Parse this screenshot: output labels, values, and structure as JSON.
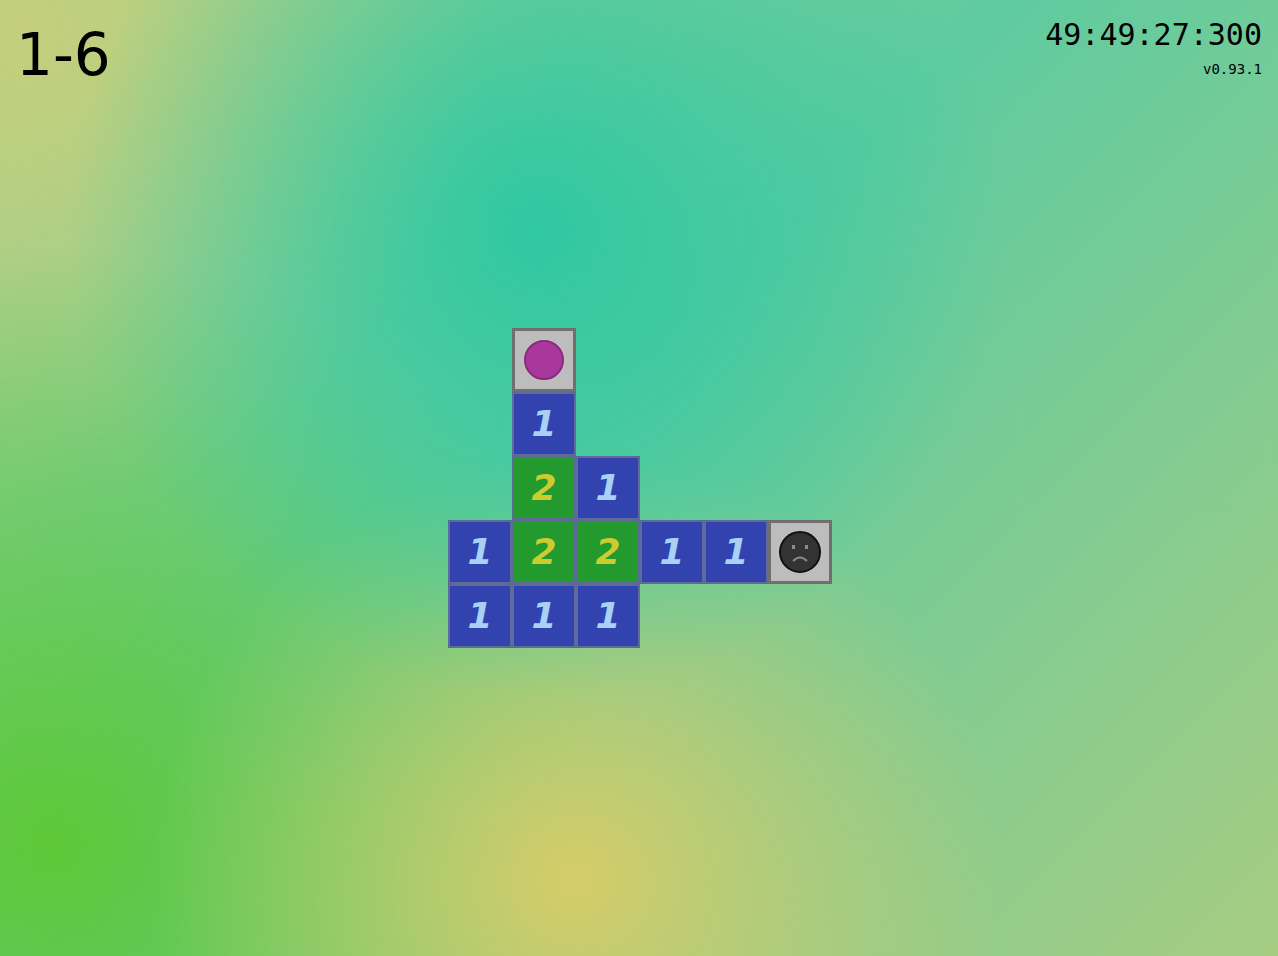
{
  "level": "1-6",
  "timer": "49:49:27:300",
  "version": "v0.93.1",
  "board": {
    "rows": [
      [
        {
          "kind": "empty"
        },
        {
          "kind": "dot"
        },
        {
          "kind": "empty"
        },
        {
          "kind": "empty"
        },
        {
          "kind": "empty"
        },
        {
          "kind": "empty"
        }
      ],
      [
        {
          "kind": "empty"
        },
        {
          "kind": "blue",
          "text": "1",
          "color": "#3243b0"
        },
        {
          "kind": "empty"
        },
        {
          "kind": "empty"
        },
        {
          "kind": "empty"
        },
        {
          "kind": "empty"
        }
      ],
      [
        {
          "kind": "empty"
        },
        {
          "kind": "green",
          "text": "2",
          "color": "#229a2e"
        },
        {
          "kind": "blue",
          "text": "1",
          "color": "#3243b0"
        },
        {
          "kind": "empty"
        },
        {
          "kind": "empty"
        },
        {
          "kind": "empty"
        }
      ],
      [
        {
          "kind": "blue",
          "text": "1",
          "color": "#3243b0"
        },
        {
          "kind": "green",
          "text": "2",
          "color": "#229a2e"
        },
        {
          "kind": "green",
          "text": "2",
          "color": "#229a2e"
        },
        {
          "kind": "blue",
          "text": "1",
          "color": "#3243b0"
        },
        {
          "kind": "blue",
          "text": "1",
          "color": "#3243b0"
        },
        {
          "kind": "face"
        }
      ],
      [
        {
          "kind": "blue",
          "text": "1",
          "color": "#3243b0"
        },
        {
          "kind": "blue",
          "text": "1",
          "color": "#3243b0"
        },
        {
          "kind": "blue",
          "text": "1",
          "color": "#3243b0"
        },
        {
          "kind": "empty"
        },
        {
          "kind": "empty"
        },
        {
          "kind": "empty"
        }
      ]
    ]
  }
}
